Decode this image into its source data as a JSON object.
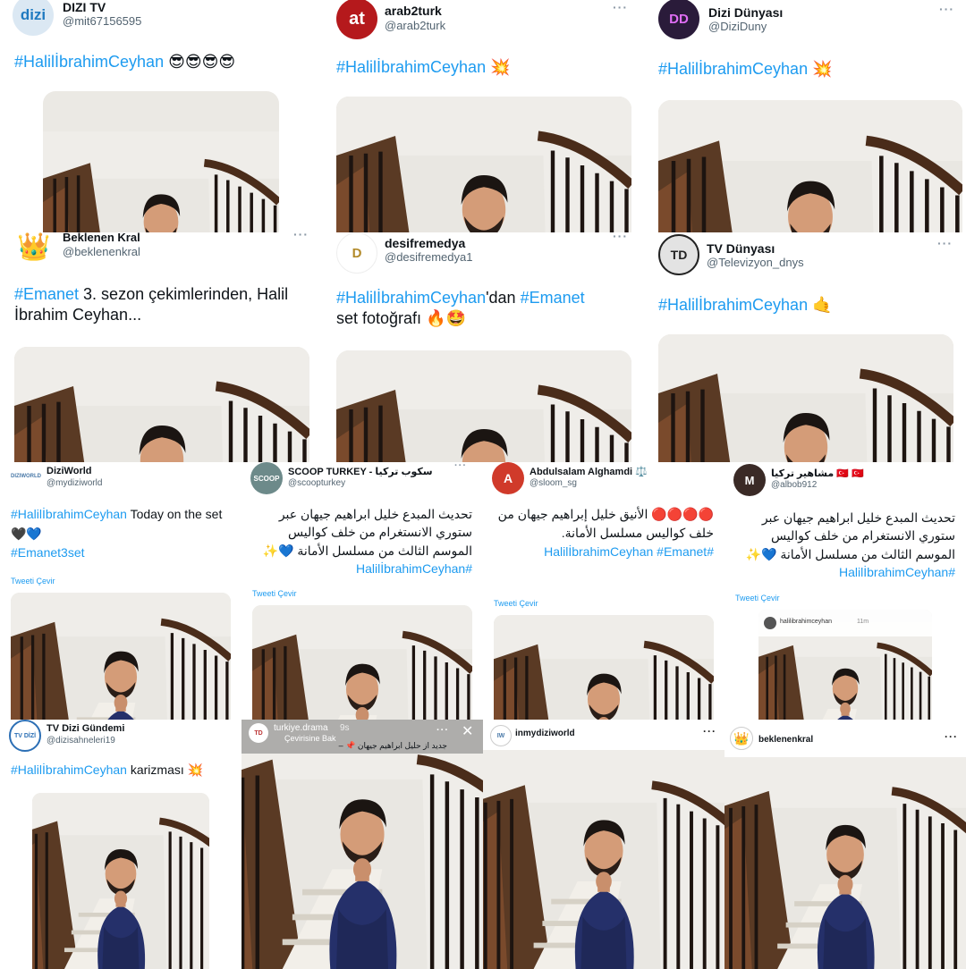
{
  "tiles": [
    {
      "name": "DIZI TV",
      "handle": "@mit67156595",
      "avatar": "dizi",
      "dots": "···",
      "text_tag": "#HalilİbrahimCeyhan",
      "text_rest": " 😎😎😎😎"
    },
    {
      "name": "arab2turk",
      "handle": "@arab2turk",
      "avatar": "at",
      "dots": "···",
      "text_tag": "#HalilİbrahimCeyhan",
      "text_rest": " 💥"
    },
    {
      "name": "Dizi Dünyası",
      "handle": "@DiziDuny",
      "avatar": "DD",
      "dots": "···",
      "text_tag": "#HalilİbrahimCeyhan",
      "text_rest": " 💥"
    },
    {
      "name": "Beklenen Kral",
      "handle": "@beklenenkral",
      "avatar": "👑",
      "dots": "···",
      "text_tag": "#Emanet",
      "text_rest": " 3. sezon çekimlerinden, Halil İbrahim Ceyhan..."
    },
    {
      "name": "desifremedya",
      "handle": "@desifremedya1",
      "avatar": "D",
      "dots": "···",
      "text_tag": "#HalilİbrahimCeyhan",
      "text_mid": "'dan ",
      "text_tag2": "#Emanet",
      "text_rest": " set fotoğrafı 🔥🤩"
    },
    {
      "name": "TV Dünyası",
      "handle": "@Televizyon_dnys",
      "avatar": "TD",
      "dots": "···",
      "text_tag": "#HalilİbrahimCeyhan",
      "text_rest": " 🤙"
    },
    {
      "name": "DiziWorld",
      "handle": "@mydiziworld",
      "avatar": "DIZIWORLD",
      "dots": "···",
      "text_tag": "#HalilİbrahimCeyhan",
      "text_rest": " Today on the set 🖤💙",
      "text_tag2": "#Emanet3set",
      "translate": "Tweeti Çevir"
    },
    {
      "name": "SCOOP TURKEY - سكوب تركيا",
      "handle": "@scoopturkey",
      "avatar": "SCOOP",
      "dots": "···",
      "text_rest": "تحديث المبدع خليل ابراهيم جيهان عبر ستوري الانستغرام من خلف كواليس الموسم الثالث من مسلسل الأمانة 💙✨",
      "text_tag": "#HalilİbrahimCeyhan",
      "translate": "Tweeti Çevir"
    },
    {
      "name": "Abdulsalam Alghamdi ⚖️",
      "handle": "@sloom_sg",
      "avatar": "A",
      "dots": "···",
      "text_rest": "🔴🔴🔴🔴 الأنيق خليل إبراهيم جيهان من خلف كواليس مسلسل الأمانة.",
      "text_tag": "#HalilİbrahimCeyhan #Emanet",
      "translate": "Tweeti Çevir"
    },
    {
      "name": "مشاهير تركيا 🇹🇷 🇹🇷",
      "handle": "@albob912",
      "avatar": "M",
      "dots": "···",
      "text_rest": "تحديث المبدع خليل ابراهيم جيهان عبر ستوري الانستغرام من خلف كواليس الموسم الثالث من مسلسل الأمانة 💙✨",
      "text_tag": "#HalilİbrahimCeyhan",
      "translate": "Tweeti Çevir",
      "story_user": "halilibrahimceyhan",
      "story_time": "11m"
    },
    {
      "name": "TV Dizi Gündemi",
      "handle": "@dizisahneleri19",
      "avatar": "TV DİZİ",
      "dots": "···",
      "text_tag": "#HalilİbrahimCeyhan",
      "text_rest": " karizması 💥"
    },
    {
      "name": "turkiye.drama",
      "time": "9s",
      "sub": "Çevirisine Bak",
      "caption": "جديد از حليل ابراهيم جيهان 📌 –",
      "close": "✕",
      "dots": "···",
      "avatar": "TD"
    },
    {
      "name": "inmydiziworld",
      "dots": "···",
      "avatar": "IW"
    },
    {
      "name": "beklenenkral",
      "dots": "···",
      "avatar": "👑"
    }
  ]
}
